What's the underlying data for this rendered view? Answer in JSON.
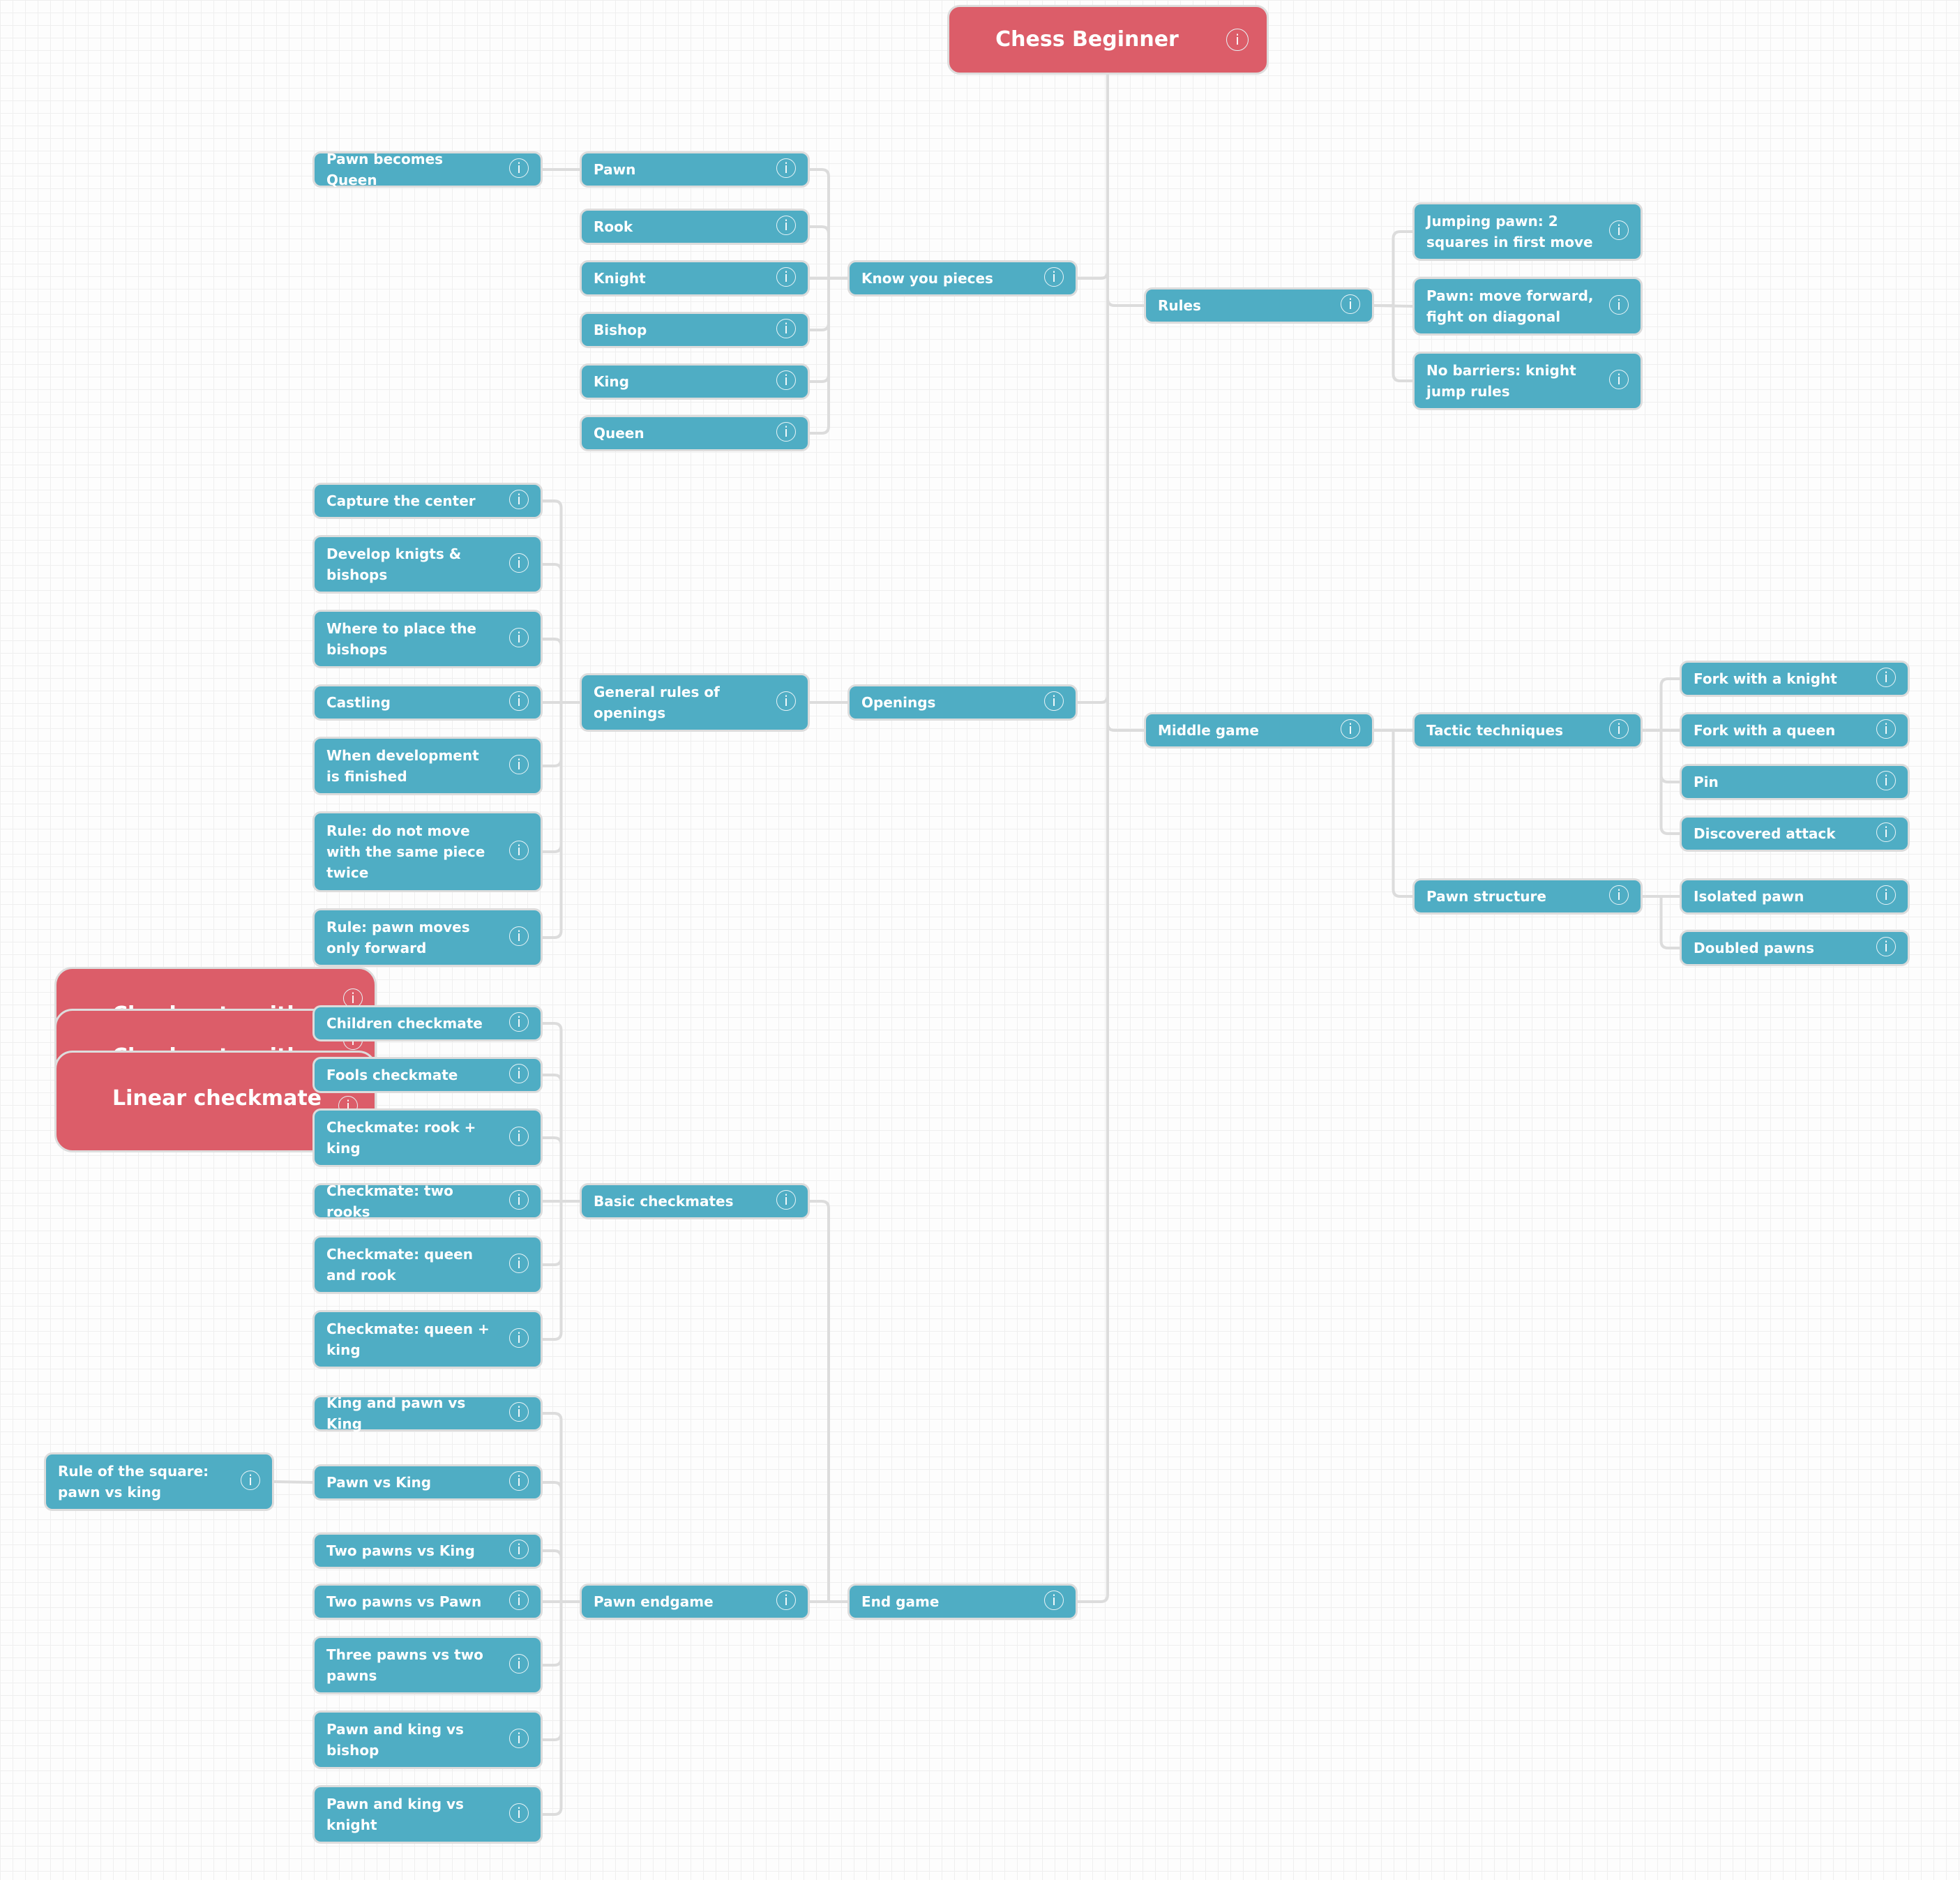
{
  "title": "Chess Beginner",
  "colors": {
    "node": "#4fadc4",
    "root": "#dc5d69",
    "connector": "#dcdcdc"
  },
  "info_icon": "i",
  "nodes": {
    "root": "Chess Beginner",
    "know_pieces": "Know you pieces",
    "pawn": "Pawn",
    "pawn_becomes_queen": "Pawn becomes Queen",
    "rook": "Rook",
    "knight": "Knight",
    "bishop": "Bishop",
    "king": "King",
    "queen": "Queen",
    "rules": "Rules",
    "jumping_pawn": "Jumping pawn: 2 squares in first move",
    "pawn_move": "Pawn: move forward, fight on diagonal",
    "no_barriers": "No barriers: knight jump rules",
    "openings": "Openings",
    "general_rules": "General rules of openings",
    "capture_center": "Capture the center",
    "develop": "Develop knigts & bishops",
    "where_bishops": "Where to place the bishops",
    "castling": "Castling",
    "when_dev": "When development is finished",
    "rule_same_piece": "Rule: do not move with the same piece twice",
    "rule_pawn_forward": "Rule: pawn moves only forward",
    "middle_game": "Middle game",
    "tactic": "Tactic techniques",
    "fork_knight": "Fork with a knight",
    "fork_queen": "Fork with a queen",
    "pin": "Pin",
    "discovered": "Discovered attack",
    "pawn_structure": "Pawn structure",
    "isolated": "Isolated pawn",
    "doubled": "Doubled pawns",
    "end_game": "End game",
    "basic_checkmates": "Basic checkmates",
    "children_cm": "Children checkmate",
    "fools_cm": "Fools checkmate",
    "cm_rook_king": "Checkmate: rook + king",
    "cm_two_rooks": "Checkmate: two rooks",
    "cm_queen_rook": "Checkmate: queen and rook",
    "cm_queen_king": "Checkmate: queen + king",
    "pawn_endgame": "Pawn endgame",
    "kp_vs_k": "King and pawn vs King",
    "pawn_vs_king": "Pawn vs King",
    "rule_square": "Rule of the square: pawn vs king",
    "two_pawns_king": "Two pawns vs King",
    "two_pawns_pawn": "Two pawns vs Pawn",
    "three_vs_two": "Three pawns vs two pawns",
    "pk_vs_bishop": "Pawn and king vs bishop",
    "pk_vs_knight": "Pawn and king vs knight",
    "drag_cm_1": "Checkmate with",
    "drag_cm_2": "Checkmate with",
    "drag_linear": "Linear checkmate"
  }
}
